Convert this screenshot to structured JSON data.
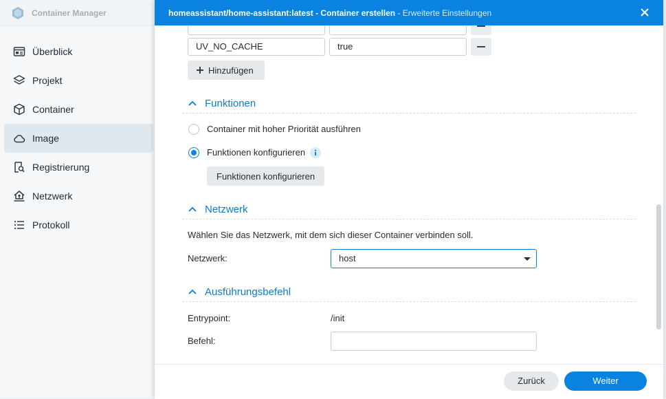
{
  "app": {
    "title": "Container Manager",
    "nav": [
      {
        "label": "Überblick",
        "icon": "overview-icon"
      },
      {
        "label": "Projekt",
        "icon": "layers-icon"
      },
      {
        "label": "Container",
        "icon": "cube-icon"
      },
      {
        "label": "Image",
        "icon": "cloud-icon",
        "active": true
      },
      {
        "label": "Registrierung",
        "icon": "registry-search-icon"
      },
      {
        "label": "Netzwerk",
        "icon": "network-house-icon"
      },
      {
        "label": "Protokoll",
        "icon": "list-icon"
      }
    ]
  },
  "dialog": {
    "title": "homeassistant/home-assistant:latest - Container erstellen",
    "separator": " - ",
    "subtitle": "Erweiterte Einstellungen",
    "env": {
      "rows": [
        {
          "key": "UV_NO_CACHE",
          "value": "true"
        }
      ],
      "add_label": "Hinzufügen"
    },
    "functions": {
      "heading": "Funktionen",
      "option_priority": "Container mit hoher Priorität ausführen",
      "option_configure": "Funktionen konfigurieren",
      "configure_button": "Funktionen konfigurieren",
      "selected": "configure"
    },
    "network": {
      "heading": "Netzwerk",
      "description": "Wählen Sie das Netzwerk, mit dem sich dieser Container verbinden soll.",
      "label": "Netzwerk:",
      "value": "host"
    },
    "exec": {
      "heading": "Ausführungsbefehl",
      "entrypoint_label": "Entrypoint:",
      "entrypoint_value": "/init",
      "command_label": "Befehl:",
      "command_value": ""
    },
    "footer": {
      "back": "Zurück",
      "next": "Weiter"
    }
  },
  "colors": {
    "accent": "#0a82e0",
    "section_heading": "#0a7dcf"
  }
}
